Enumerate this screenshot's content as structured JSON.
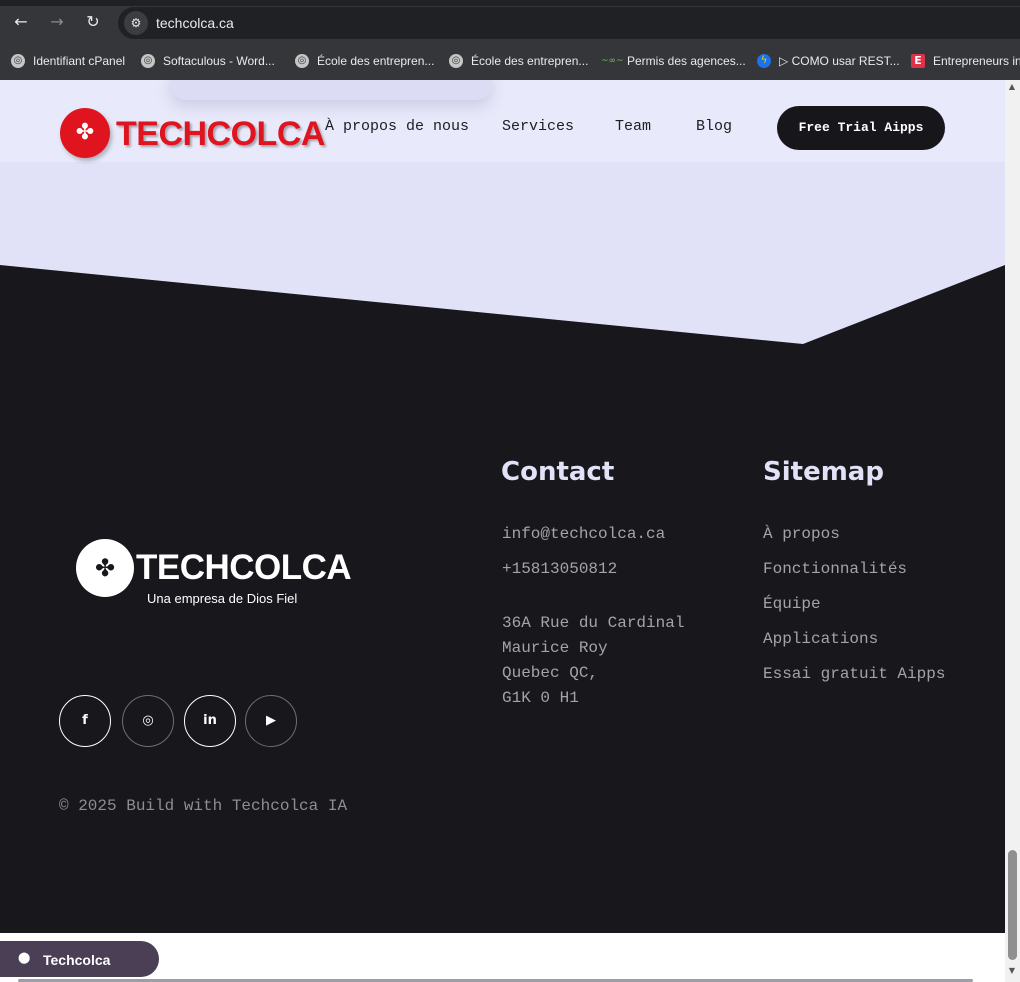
{
  "browser": {
    "url": "techcolca.ca",
    "back_icon": "←",
    "forward_icon": "→",
    "reload_icon": "↻",
    "site_info_icon": "⚙",
    "bookmarks": [
      {
        "label": "Identifiant cPanel",
        "icon": "globe-icon",
        "glyph": "◎"
      },
      {
        "label": "Softaculous - Word...",
        "icon": "globe-icon",
        "glyph": "◎"
      },
      {
        "label": "École des entrepren...",
        "icon": "globe-icon",
        "glyph": "◎"
      },
      {
        "label": "École des entrepren...",
        "icon": "globe-icon",
        "glyph": "◎"
      },
      {
        "label": "Permis des agences...",
        "icon": "permis-icon",
        "glyph": "~∞~"
      },
      {
        "label": "▷ COMO usar REST...",
        "icon": "bolt-icon",
        "glyph": "ϟ"
      },
      {
        "label": "Entrepreneurs in",
        "icon": "e-icon",
        "glyph": "E"
      }
    ]
  },
  "header": {
    "logo_text": "TECHCOLCA",
    "logo_glyph": "✤",
    "nav": [
      "À propos de nous",
      "Services",
      "Team",
      "Blog"
    ],
    "cta_label": "Free Trial Aipps",
    "bg_color": "#e8e9fa",
    "brand_color": "#e0141e"
  },
  "footer": {
    "logo_text": "TECHCOLCA",
    "logo_glyph": "✤",
    "tagline": "Una empresa de Dios Fiel",
    "social": [
      {
        "name": "facebook-icon",
        "glyph": "f"
      },
      {
        "name": "instagram-icon",
        "glyph": "◎"
      },
      {
        "name": "linkedin-icon",
        "glyph": "in"
      },
      {
        "name": "youtube-icon",
        "glyph": "▶"
      }
    ],
    "copyright": "© 2025 Build with Techcolca IA",
    "contact": {
      "title": "Contact",
      "email": "info@techcolca.ca",
      "phone": "+15813050812",
      "address": [
        "36A Rue du Cardinal",
        "Maurice Roy",
        "Quebec QC,",
        "G1K 0 H1"
      ]
    },
    "sitemap": {
      "title": "Sitemap",
      "items": [
        "À propos",
        "Fonctionnalités",
        "Équipe",
        "Applications",
        "Essai gratuit Aipps"
      ]
    },
    "bg_color": "#18171c"
  },
  "floating_widget": {
    "label": "Techcolca",
    "icon_glyph": "⬤"
  },
  "scrollbar": {
    "up_icon": "▲",
    "down_icon": "▼"
  }
}
